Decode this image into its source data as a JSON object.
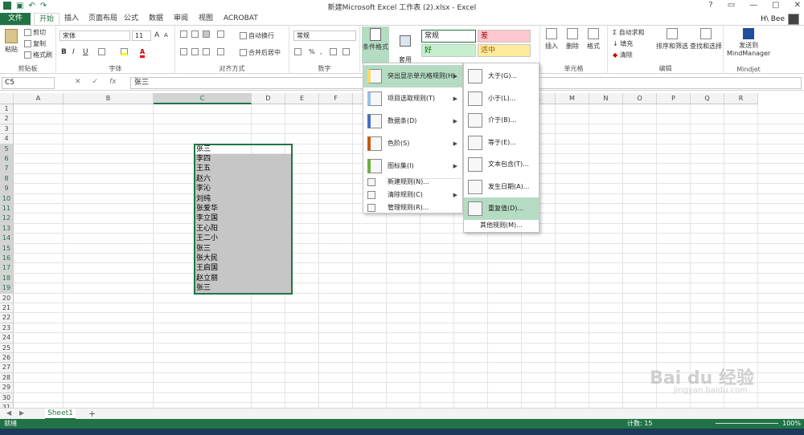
{
  "titlebar": {
    "title": "新建Microsoft Excel 工作表 (2).xlsx - Excel",
    "controls": [
      "?",
      "▭",
      "—",
      "▢",
      "✕"
    ]
  },
  "tabs": [
    "文件",
    "开始",
    "插入",
    "页面布局",
    "公式",
    "数据",
    "审阅",
    "视图",
    "ACROBAT"
  ],
  "user": {
    "name": "H\\ Bee"
  },
  "ribbon": {
    "clipboard": {
      "paste": "粘贴",
      "cut": "剪切",
      "copy": "复制",
      "format_painter": "格式刷",
      "label": "剪贴板"
    },
    "font": {
      "name": "宋体",
      "size": "11",
      "grow": "A",
      "shrink": "A",
      "bold": "B",
      "italic": "I",
      "underline": "U",
      "label": "字体"
    },
    "alignment": {
      "wrap": "自动换行",
      "merge": "合并后居中",
      "label": "对齐方式"
    },
    "number": {
      "format": "常规",
      "label": "数字"
    },
    "styles": {
      "cond_format": "条件格式",
      "table_format": "套用\n表格格式",
      "normal": "常规",
      "bad": "差",
      "good": "好",
      "neutral": "适中",
      "label": "样式"
    },
    "cells": {
      "insert": "插入",
      "delete": "删除",
      "format": "格式",
      "label": "单元格"
    },
    "editing": {
      "autosum": "自动求和",
      "fill": "填充",
      "clear": "清除",
      "sort": "排序和筛选",
      "find": "查找和选择",
      "label": "编辑"
    },
    "mindjet": {
      "send": "发送到\nMindManager",
      "label": "Mindjet"
    }
  },
  "formula": {
    "namebox": "C5",
    "value": "张三",
    "fx": "fx"
  },
  "columns": [
    "A",
    "B",
    "C",
    "D",
    "E",
    "F",
    "G",
    "H",
    "I",
    "J",
    "K",
    "L",
    "M",
    "N",
    "O",
    "P",
    "Q",
    "R"
  ],
  "rows": [
    "1",
    "2",
    "3",
    "4",
    "5",
    "6",
    "7",
    "8",
    "9",
    "10",
    "11",
    "12",
    "13",
    "14",
    "15",
    "16",
    "17",
    "18",
    "19",
    "20",
    "21",
    "22",
    "23",
    "24",
    "25",
    "26",
    "27",
    "28",
    "29",
    "30",
    "31",
    "32"
  ],
  "cells_c": [
    "张三",
    "李四",
    "王五",
    "赵六",
    "李沁",
    "刘纯",
    "张爱华",
    "李立国",
    "王心阳",
    "王二小",
    "张三",
    "张大民",
    "王启国",
    "赵立丽",
    "张三"
  ],
  "menu": {
    "items": [
      "突出显示单元格规则(H)",
      "项目选取规则(T)",
      "数据条(D)",
      "色阶(S)",
      "图标集(I)"
    ],
    "small": [
      "新建规则(N)...",
      "清除规则(C)",
      "管理规则(R)..."
    ]
  },
  "submenu": {
    "items": [
      "大于(G)...",
      "小于(L)...",
      "介于(B)...",
      "等于(E)...",
      "文本包含(T)...",
      "发生日期(A)...",
      "重复值(D)..."
    ],
    "more": "其他规则(M)..."
  },
  "sheet": {
    "name": "Sheet1",
    "add": "+"
  },
  "status": {
    "ready": "就绪",
    "count": "计数: 15",
    "zoom": "100%"
  },
  "watermark": {
    "brand": "Bai du 经验",
    "url": "jingyan.baidu.com"
  }
}
